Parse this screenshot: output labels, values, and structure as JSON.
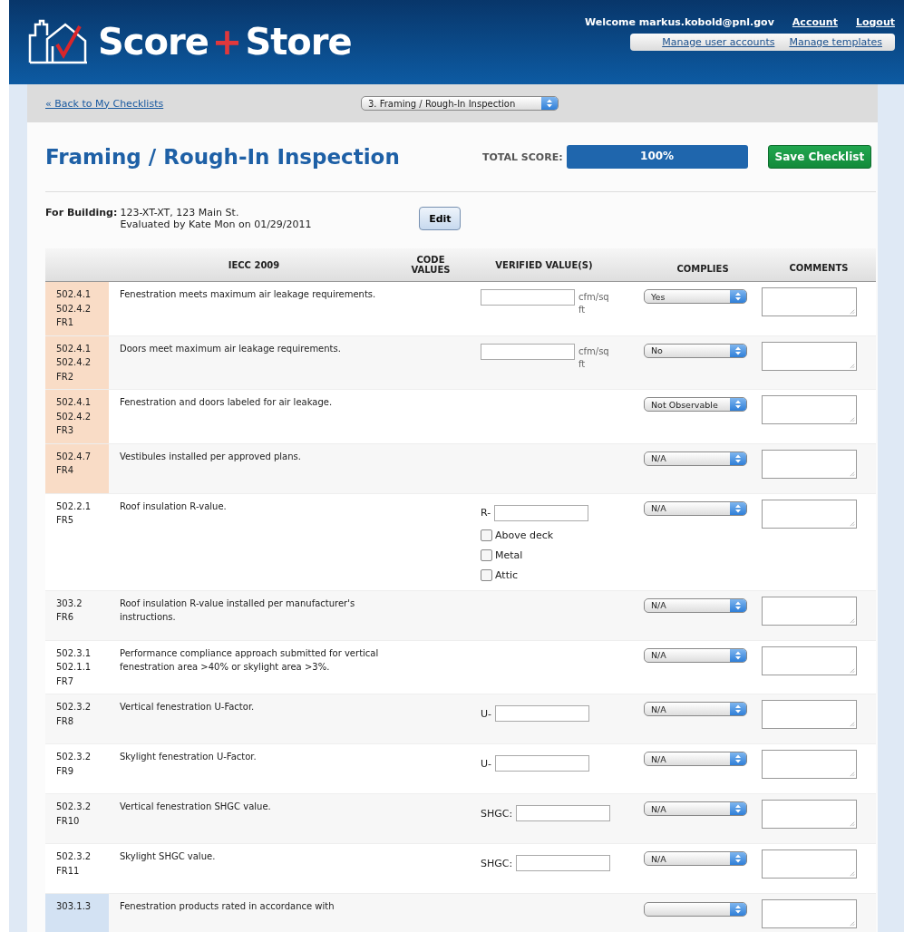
{
  "header": {
    "brand_left": "Score",
    "brand_plus": "+",
    "brand_right": "Store",
    "welcome": "Welcome markus.kobold@pnl.gov",
    "links": [
      "Account",
      "Logout"
    ],
    "admin_links": [
      "Manage user accounts",
      "Manage templates"
    ]
  },
  "subbar": {
    "back_link": "« Back to My Checklists",
    "checklist_select": "3. Framing / Rough-In Inspection"
  },
  "title": "Framing / Rough-In Inspection",
  "score": {
    "label": "TOTAL SCORE:",
    "level": 1.0,
    "reading": "100%"
  },
  "save_button": "Save Checklist",
  "building": {
    "label": "For Building:",
    "name": "123-XT-XT, 123 Main St.",
    "evaluated": "Evaluated by Kate Mon on 01/29/2011",
    "edit_button": "Edit"
  },
  "table": {
    "columns": [
      "IECC 2009",
      "CODE VALUES",
      "VERIFIED VALUE(S)",
      "COMPLIES",
      "COMMENTS"
    ],
    "rows": [
      {
        "codes": [
          "502.4.1",
          "502.4.2",
          "FR1"
        ],
        "color": "#f9dcc6",
        "description": "Fenestration meets maximum air leakage requirements.",
        "verified": {
          "kind": "unit",
          "unit": "cfm/sq ft"
        },
        "complies": "Yes"
      },
      {
        "codes": [
          "502.4.1",
          "502.4.2",
          "FR2"
        ],
        "color": "#f9dcc6",
        "description": "Doors meet maximum air leakage requirements.",
        "verified": {
          "kind": "unit",
          "unit": "cfm/sq ft"
        },
        "complies": "No"
      },
      {
        "codes": [
          "502.4.1",
          "502.4.2",
          "FR3"
        ],
        "color": "#f9dcc6",
        "description": "Fenestration and doors labeled for air leakage.",
        "complies": "Not Observable"
      },
      {
        "codes": [
          "502.4.7",
          "FR4"
        ],
        "color": "#f9dcc6",
        "description": "Vestibules installed per approved plans.",
        "complies": "N/A"
      },
      {
        "codes": [
          "502.2.1",
          "FR5"
        ],
        "description": "Roof insulation R-value.",
        "verified": {
          "kind": "prefix",
          "prefix": "R-",
          "options": [
            {
              "label": "Above deck",
              "checked": false
            },
            {
              "label": "Metal",
              "checked": false
            },
            {
              "label": "Attic",
              "checked": false
            }
          ]
        },
        "complies": "N/A"
      },
      {
        "codes": [
          "303.2",
          "FR6"
        ],
        "description": "Roof insulation R-value installed per manufacturer's instructions.",
        "complies": "N/A"
      },
      {
        "codes": [
          "502.3.1",
          "502.1.1",
          "FR7"
        ],
        "description": "Performance compliance approach submitted for vertical fenestration area >40% or skylight area >3%.",
        "complies": "N/A"
      },
      {
        "codes": [
          "502.3.2",
          "FR8"
        ],
        "description": "Vertical fenestration U-Factor.",
        "verified": {
          "kind": "prefix",
          "prefix": "U-"
        },
        "complies": "N/A"
      },
      {
        "codes": [
          "502.3.2",
          "FR9"
        ],
        "description": "Skylight fenestration U-Factor.",
        "verified": {
          "kind": "prefix",
          "prefix": "U-"
        },
        "complies": "N/A"
      },
      {
        "codes": [
          "502.3.2",
          "FR10"
        ],
        "description": "Vertical fenestration SHGC value.",
        "verified": {
          "kind": "prefix",
          "prefix": "SHGC:"
        },
        "complies": "N/A"
      },
      {
        "codes": [
          "502.3.2",
          "FR11"
        ],
        "description": "Skylight SHGC value.",
        "verified": {
          "kind": "prefix",
          "prefix": "SHGC:"
        },
        "complies": "N/A"
      },
      {
        "codes": [
          "303.1.3"
        ],
        "color": "#d3e2f3",
        "description": "Fenestration products rated in accordance with"
      }
    ]
  }
}
